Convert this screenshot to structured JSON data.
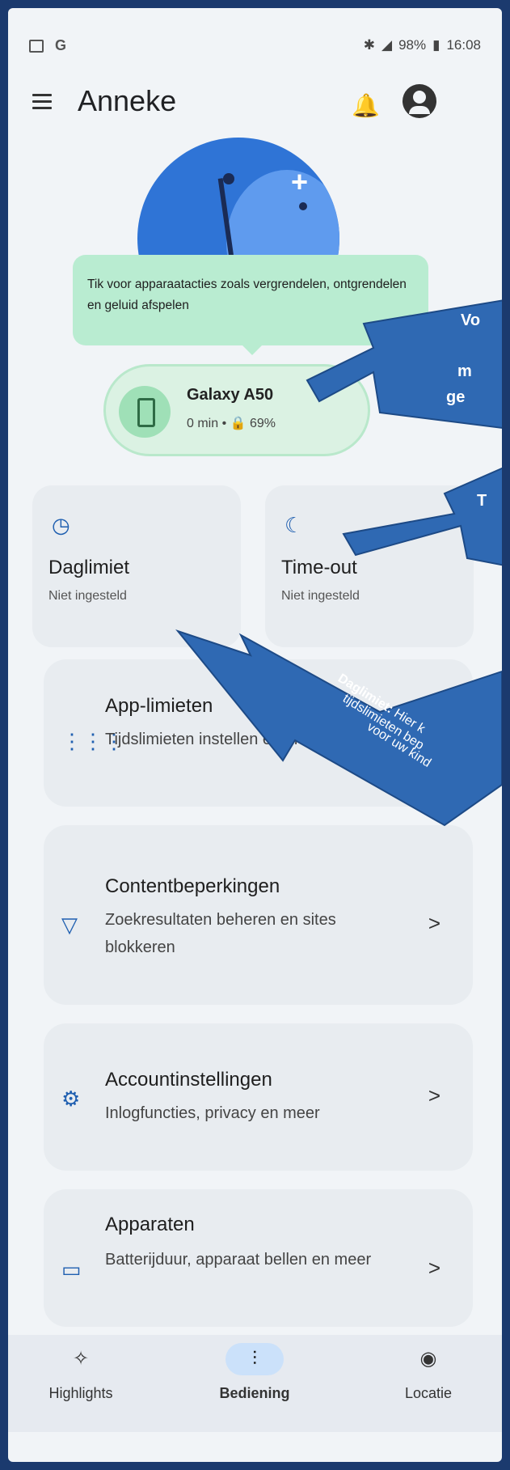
{
  "status_bar": {
    "battery": "98%",
    "time": "16:08",
    "left_label": "G"
  },
  "app_bar": {
    "title": "Anneke"
  },
  "tooltip": {
    "text": "Tik voor apparaatacties zoals vergrendelen, ontgrendelen en geluid afspelen"
  },
  "device": {
    "name": "Galaxy A50",
    "meta": "0 min • 🔒 69%"
  },
  "tiles": [
    {
      "label": "Daglimiet",
      "sub": "Niet ingesteld"
    },
    {
      "label": "Time-out",
      "sub": "Niet ingesteld"
    }
  ],
  "rows": [
    {
      "title": "App-limieten",
      "desc": "Tijdslimieten instellen en blokkeren"
    },
    {
      "title": "Contentbeperkingen",
      "desc": "Zoekresultaten beheren en sites blokkeren",
      "chevron": ">"
    },
    {
      "title": "Accountinstellingen",
      "desc": "Inlogfuncties, privacy en meer",
      "chevron": ">"
    },
    {
      "title": "Apparaten",
      "desc": "Batterijduur, apparaat bellen en meer",
      "chevron": ">"
    }
  ],
  "nav": [
    {
      "label": "Highlights"
    },
    {
      "label": "Bediening"
    },
    {
      "label": "Locatie"
    }
  ],
  "annotations": {
    "arrow1_lines": [
      "Vo",
      "m",
      "ge"
    ],
    "arrow2_line": "T",
    "daglimiet_bold": "Daglimiet:",
    "daglimiet_rest": "Hier k",
    "daglimiet_line2": "tijdslimieten bep",
    "daglimiet_line3": "voor uw kind"
  }
}
